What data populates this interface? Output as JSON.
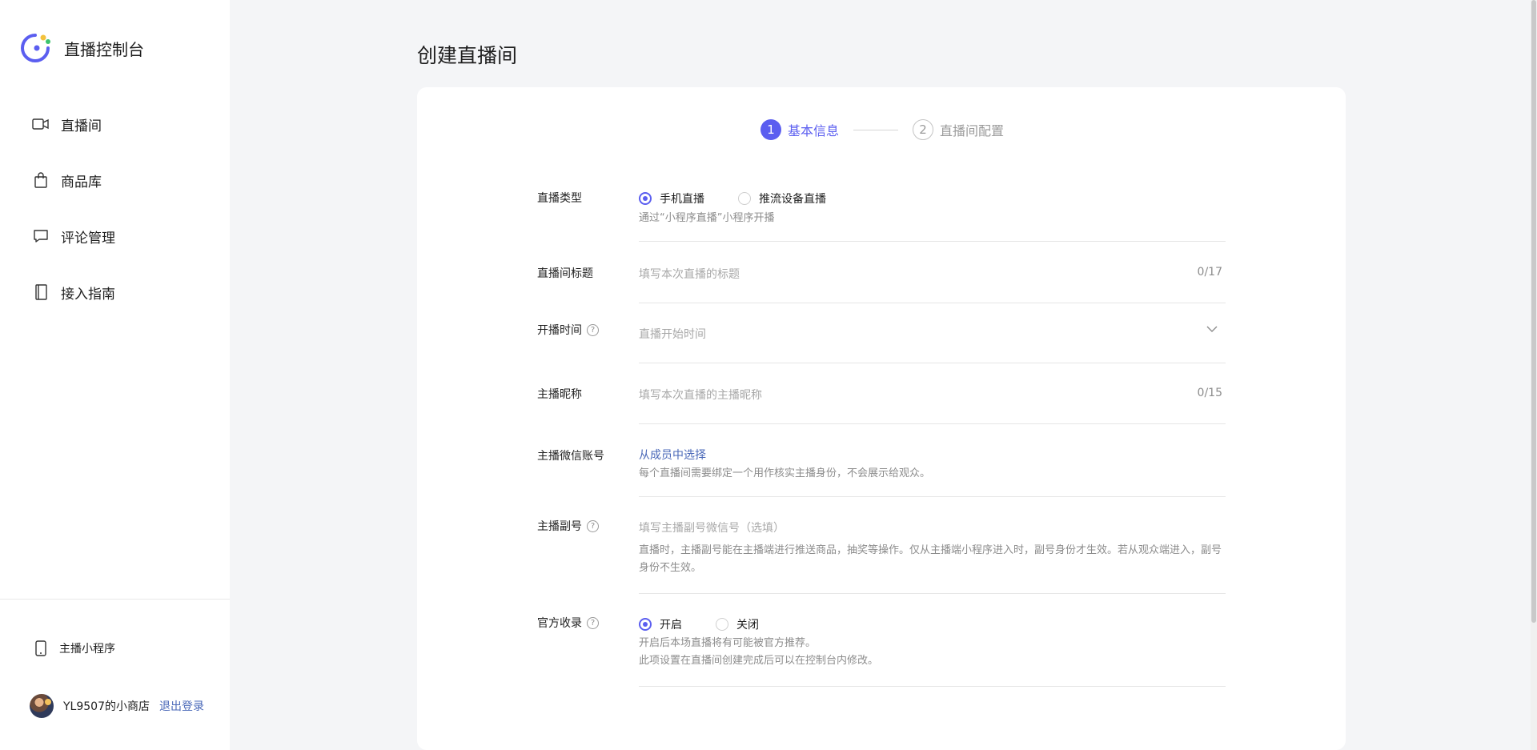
{
  "sidebar": {
    "title": "直播控制台",
    "items": [
      {
        "label": "直播间",
        "icon": "video-camera-icon"
      },
      {
        "label": "商品库",
        "icon": "shopping-bag-icon"
      },
      {
        "label": "评论管理",
        "icon": "comment-icon"
      },
      {
        "label": "接入指南",
        "icon": "book-icon"
      }
    ],
    "mini_app_label": "主播小程序",
    "user_name": "YL9507的小商店",
    "logout_label": "退出登录"
  },
  "page": {
    "title": "创建直播间"
  },
  "steps": [
    {
      "num": "1",
      "label": "基本信息",
      "active": true
    },
    {
      "num": "2",
      "label": "直播间配置",
      "active": false
    }
  ],
  "form": {
    "live_type": {
      "label": "直播类型",
      "options": [
        "手机直播",
        "推流设备直播"
      ],
      "selected": "手机直播",
      "hint": "通过“小程序直播”小程序开播"
    },
    "title": {
      "label": "直播间标题",
      "placeholder": "填写本次直播的标题",
      "counter": "0/17"
    },
    "start_time": {
      "label": "开播时间",
      "placeholder": "直播开始时间"
    },
    "anchor_nickname": {
      "label": "主播昵称",
      "placeholder": "填写本次直播的主播昵称",
      "counter": "0/15"
    },
    "anchor_wechat": {
      "label": "主播微信账号",
      "link": "从成员中选择",
      "hint": "每个直播间需要绑定一个用作核实主播身份，不会展示给观众。"
    },
    "assistant": {
      "label": "主播副号",
      "placeholder": "填写主播副号微信号（选填）",
      "hint": "直播时，主播副号能在主播端进行推送商品，抽奖等操作。仅从主播端小程序进入时，副号身份才生效。若从观众端进入，副号身份不生效。"
    },
    "official": {
      "label": "官方收录",
      "options": [
        "开启",
        "关闭"
      ],
      "selected": "开启",
      "hint1": "开启后本场直播将有可能被官方推荐。",
      "hint2": "此项设置在直播间创建完成后可以在控制台内修改。"
    }
  },
  "colors": {
    "accent": "#5b5ef0",
    "link": "#4a68b8",
    "background": "#f4f5f7"
  }
}
